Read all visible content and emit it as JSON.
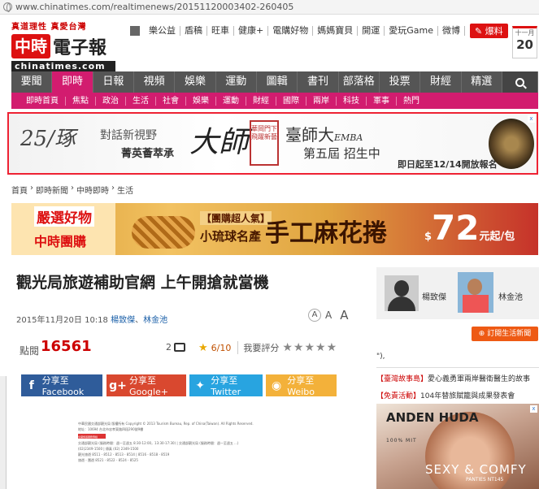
{
  "browser": {
    "url": "www.chinatimes.com/realtimenews/20151120003402-260405"
  },
  "header": {
    "slogan": "真道理性 真愛台灣",
    "logo_red": "中時",
    "logo_black": "電子報",
    "logo_domain": "chinatimes.com",
    "topnav": [
      "樂公益",
      "盾稿",
      "旺車",
      "健康+",
      "電購好物",
      "媽媽寶貝",
      "開運",
      "愛玩Game",
      "微博"
    ],
    "report_label": "爆料",
    "date_month": "十一月",
    "date_day": "20"
  },
  "mainnav": {
    "tabs": [
      "要聞",
      "即時",
      "日報",
      "視頻",
      "娛樂",
      "運動",
      "圖輯",
      "書刊",
      "部落格",
      "投票",
      "財經",
      "精選"
    ],
    "active": "即時"
  },
  "subnav": {
    "items": [
      "即時首頁",
      "焦點",
      "政治",
      "生活",
      "社會",
      "娛樂",
      "運動",
      "財經",
      "國際",
      "兩岸",
      "科技",
      "軍事",
      "熱門"
    ]
  },
  "ad1": {
    "cali": "25/琢",
    "t1": "對話新視野",
    "t2": "菁英薈萃承",
    "big": "大師",
    "seal": "華岡門下飛躍新藝",
    "emba_title": "臺師大",
    "emba_suffix": "EMBA",
    "emba_sub": "第五屆 招生中",
    "deadline": "即日起至12/14開放報名",
    "close": "x"
  },
  "breadcrumb": [
    "首頁",
    "即時新聞",
    "中時即時",
    "生活"
  ],
  "ad2": {
    "pick": "嚴選好物",
    "brand": "中時團購",
    "pop": "【團購超人氣】",
    "small": "小琉球名產",
    "title": "手工麻花捲",
    "price_currency": "$",
    "price_value": "72",
    "price_unit": "元起/包"
  },
  "article": {
    "title": "觀光局旅遊補助官網 上午開搶就當機",
    "date": "2015年11月20日 10:18",
    "author1": "楊致傑",
    "author2": "林金池",
    "views_label": "點閱",
    "views": "16561",
    "comments": "2",
    "rating": "6/10",
    "rate_label": "我要評分",
    "font_a1": "A",
    "font_a2": "A",
    "font_a3": "A"
  },
  "share": {
    "facebook": "分享至Facebook",
    "google": "分享至Google+",
    "twitter": "分享至Twitter",
    "weibo": "分享至Weibo"
  },
  "doc": {
    "line1": "中華民國交通部觀光局 版權所有 Copyright © 2013 Tourism Bureau, Rep. of China(Taiwan). All Rights Reserved.",
    "line2": "地址：10694 台北市忠孝東路四段290號9樓",
    "line3": "交通部觀光局 (服務時間：週一至週五 8:30-12:00，13:30-17:30) | 交通部觀光局 (服務時間：週一至週五 ...)",
    "line4": "(02)2349-1500 | 傳真 (02) 2349-1500",
    "line5": "觀光旅遊 8511 - 8512 - 8513 - 8514 | 8516 - 8518 - 8519",
    "line6": "旅遊 - 團遊 8521 - 8522 - 8524 - 8525",
    "redbox_label": "全國旅遊服務專線"
  },
  "sidebar": {
    "author1": "楊致傑",
    "author2": "林金池",
    "subscribe": "訂閱生活新聞",
    "hint": "\"),",
    "news1_tag": "【臺灣故事島】",
    "news1": "愛心義勇軍兩岸醫衛醫生的故事",
    "news2_tag": "【免責活動】",
    "news2": "104年替旅賦籠與成果發表會"
  },
  "ad3": {
    "brand": "ANDEN HUDA",
    "sub": "100% MIT",
    "slogan": "SEXY & COMFY",
    "price": "PANTIES NT145",
    "close": "x"
  },
  "colors": {
    "accent": "#d21c6f",
    "nav_bg": "#555555",
    "brand_red": "#d11111"
  }
}
